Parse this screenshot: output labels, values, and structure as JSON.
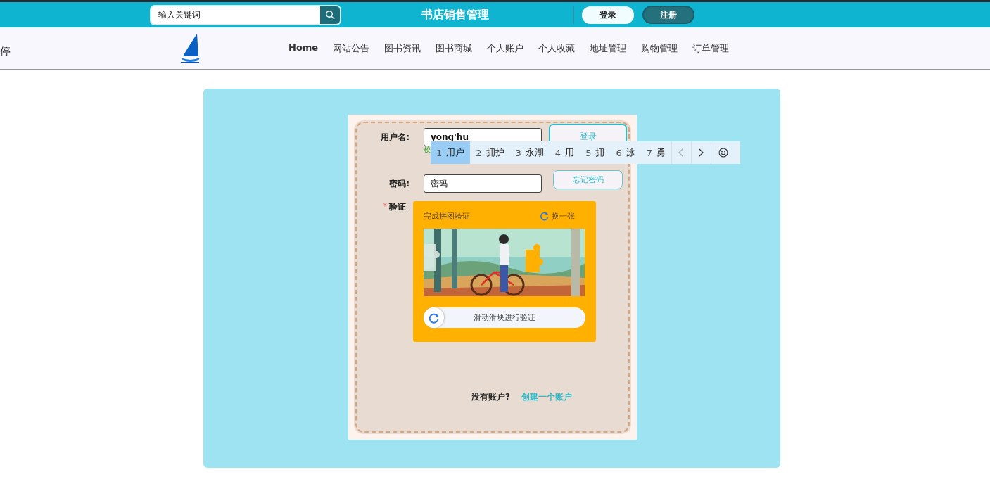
{
  "header": {
    "search": {
      "placeholder": "输入关键词"
    },
    "title": "书店销售管理",
    "login": "登录",
    "register": "注册"
  },
  "nav": {
    "edge_text": "停",
    "items": [
      {
        "label": "Home"
      },
      {
        "label": "网站公告"
      },
      {
        "label": "图书资讯"
      },
      {
        "label": "图书商城"
      },
      {
        "label": "个人账户"
      },
      {
        "label": "个人收藏"
      },
      {
        "label": "地址管理"
      },
      {
        "label": "购物管理"
      },
      {
        "label": "订单管理"
      }
    ]
  },
  "form": {
    "username_label": "用户名:",
    "username_value": "yong'hu",
    "login_button": "登录",
    "hint": "校",
    "password_label": "密码:",
    "password_value": "密码",
    "forgot_button": "忘记密码",
    "captcha": {
      "label": "验证",
      "required_mark": "*",
      "title": "完成拼图验证",
      "refresh": "换一张",
      "slider": "滑动滑块进行验证"
    },
    "question": "没有账户?",
    "create_link": "创建一个账户"
  },
  "ime": {
    "candidates": [
      {
        "index": "1",
        "text": "用户",
        "selected": true
      },
      {
        "index": "2",
        "text": "拥护",
        "selected": false
      },
      {
        "index": "3",
        "text": "永湖",
        "selected": false
      },
      {
        "index": "4",
        "text": "用",
        "selected": false
      },
      {
        "index": "5",
        "text": "拥",
        "selected": false
      },
      {
        "index": "6",
        "text": "泳",
        "selected": false
      },
      {
        "index": "7",
        "text": "勇",
        "selected": false
      }
    ]
  }
}
